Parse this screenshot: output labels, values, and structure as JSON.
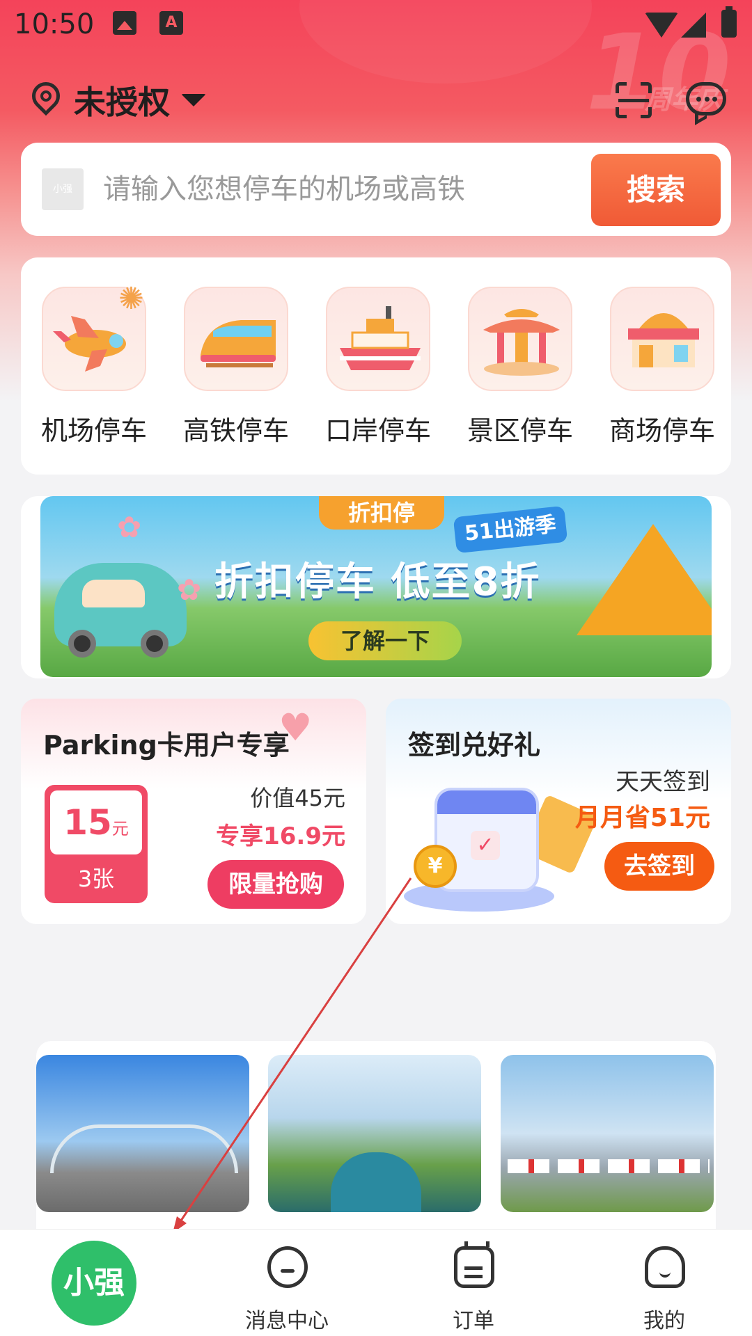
{
  "status_bar": {
    "time": "10:50",
    "notification_icons": [
      "image-icon",
      "a-badge-icon"
    ],
    "system_icons": [
      "wifi-icon",
      "signal-icon",
      "battery-charging-icon"
    ]
  },
  "header": {
    "location_label": "未授权",
    "location_icon": "location-pin-icon",
    "dropdown_icon": "caret-down-icon",
    "scan_icon": "scan-icon",
    "message_icon": "chat-bubble-icon",
    "decoration_text": "10",
    "decoration_sub": "周年庆"
  },
  "search": {
    "logo_text": "小强",
    "placeholder": "请输入您想停车的机场或高铁",
    "button_label": "搜索"
  },
  "categories": [
    {
      "label": "机场停车",
      "icon": "airplane-icon"
    },
    {
      "label": "高铁停车",
      "icon": "bullet-train-icon"
    },
    {
      "label": "口岸停车",
      "icon": "ship-icon"
    },
    {
      "label": "景区停车",
      "icon": "pavilion-icon"
    },
    {
      "label": "商场停车",
      "icon": "mall-icon"
    }
  ],
  "banner": {
    "tag": "折扣停",
    "badge": "51出游季",
    "headline": "折扣停车 低至8折",
    "cta": "了解一下"
  },
  "parking_card": {
    "title": "Parking卡用户专享",
    "coupon_amount": "15",
    "coupon_unit": "元",
    "coupon_count": "3张",
    "worth": "价值45元",
    "price": "专享16.9元",
    "button": "限量抢购"
  },
  "signin_card": {
    "title": "签到兑好礼",
    "daily": "天天签到",
    "saving": "月月省51元",
    "button": "去签到"
  },
  "bottom_nav": {
    "home_label": "小强",
    "items": [
      {
        "label": "消息中心",
        "icon": "message-icon"
      },
      {
        "label": "订单",
        "icon": "order-icon"
      },
      {
        "label": "我的",
        "icon": "profile-icon"
      }
    ]
  },
  "colors": {
    "brand_red": "#f4435a",
    "search_button": "#f05a36",
    "coupon_pink": "#f04a66",
    "signin_orange": "#f55b12",
    "home_green": "#2fbf6a"
  }
}
